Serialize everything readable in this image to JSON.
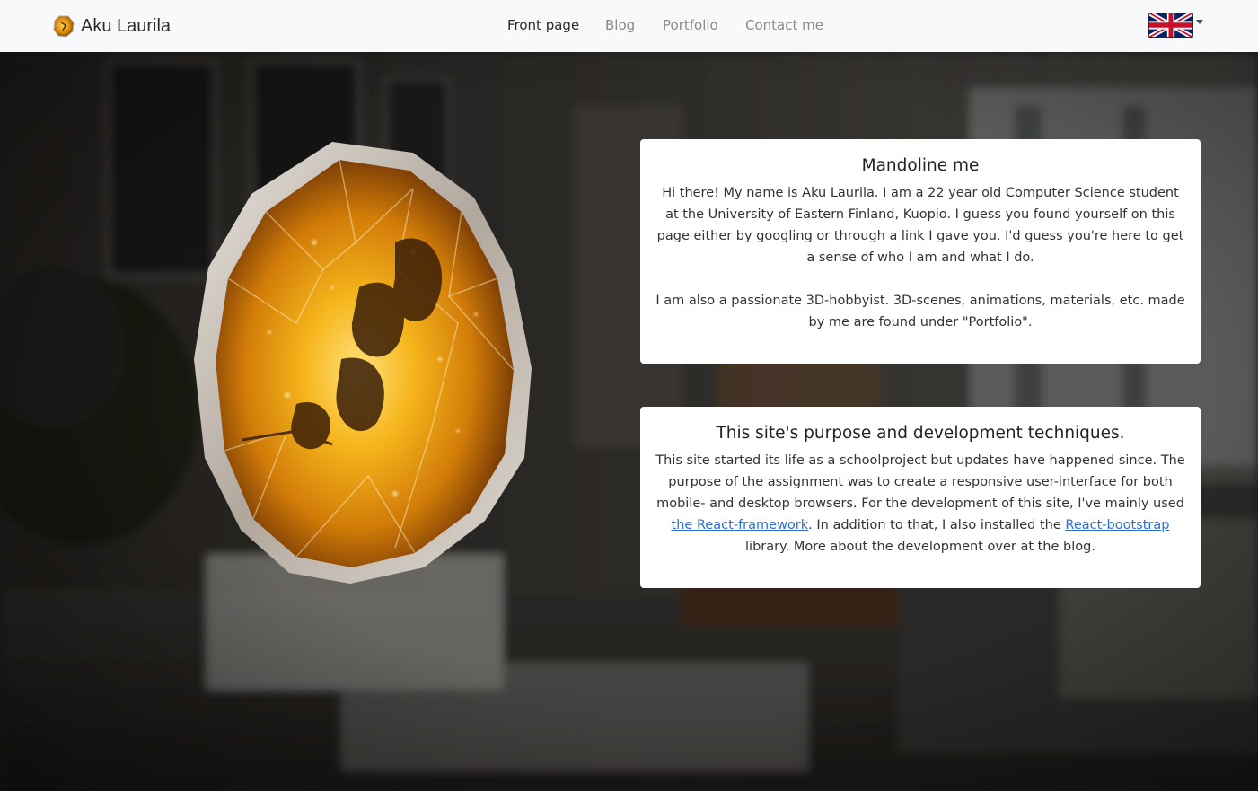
{
  "navbar": {
    "brand": "Aku Laurila",
    "links": [
      {
        "label": "Front page",
        "active": true
      },
      {
        "label": "Blog",
        "active": false
      },
      {
        "label": "Portfolio",
        "active": false
      },
      {
        "label": "Contact me",
        "active": false
      }
    ],
    "language_icon": "uk-flag-icon"
  },
  "card1": {
    "title": "Mandoline me",
    "p1": "Hi there! My name is Aku Laurila. I am a 22 year old Computer Science student at the University of Eastern Finland, Kuopio. I guess you found yourself on this page either by googling or through a link I gave you. I'd guess you're here to get a sense of who I am and what I do.",
    "p2": "I am also a passionate 3D-hobbyist. 3D-scenes, animations, materials, etc. made by me are found under \"Portfolio\"."
  },
  "card2": {
    "title": "This site's purpose and development techniques.",
    "text_before_link1": "This site started its life as a schoolproject but updates have happened since. The purpose of the assignment was to create a responsive user-interface for both mobile- and desktop browsers. For the development of this site, I've mainly used ",
    "link1": "the React-framework",
    "text_between_links": ". In addition to that, I also installed the ",
    "link2": "React-bootstrap",
    "text_after_link2": " library. More about the development over at the blog."
  },
  "colors": {
    "navbar_bg": "#f8f9fa",
    "link_active": "#2b2b2b",
    "link_inactive": "#8a8a8a",
    "hyperlink": "#2a6fd6",
    "amber": "#f0a010"
  }
}
